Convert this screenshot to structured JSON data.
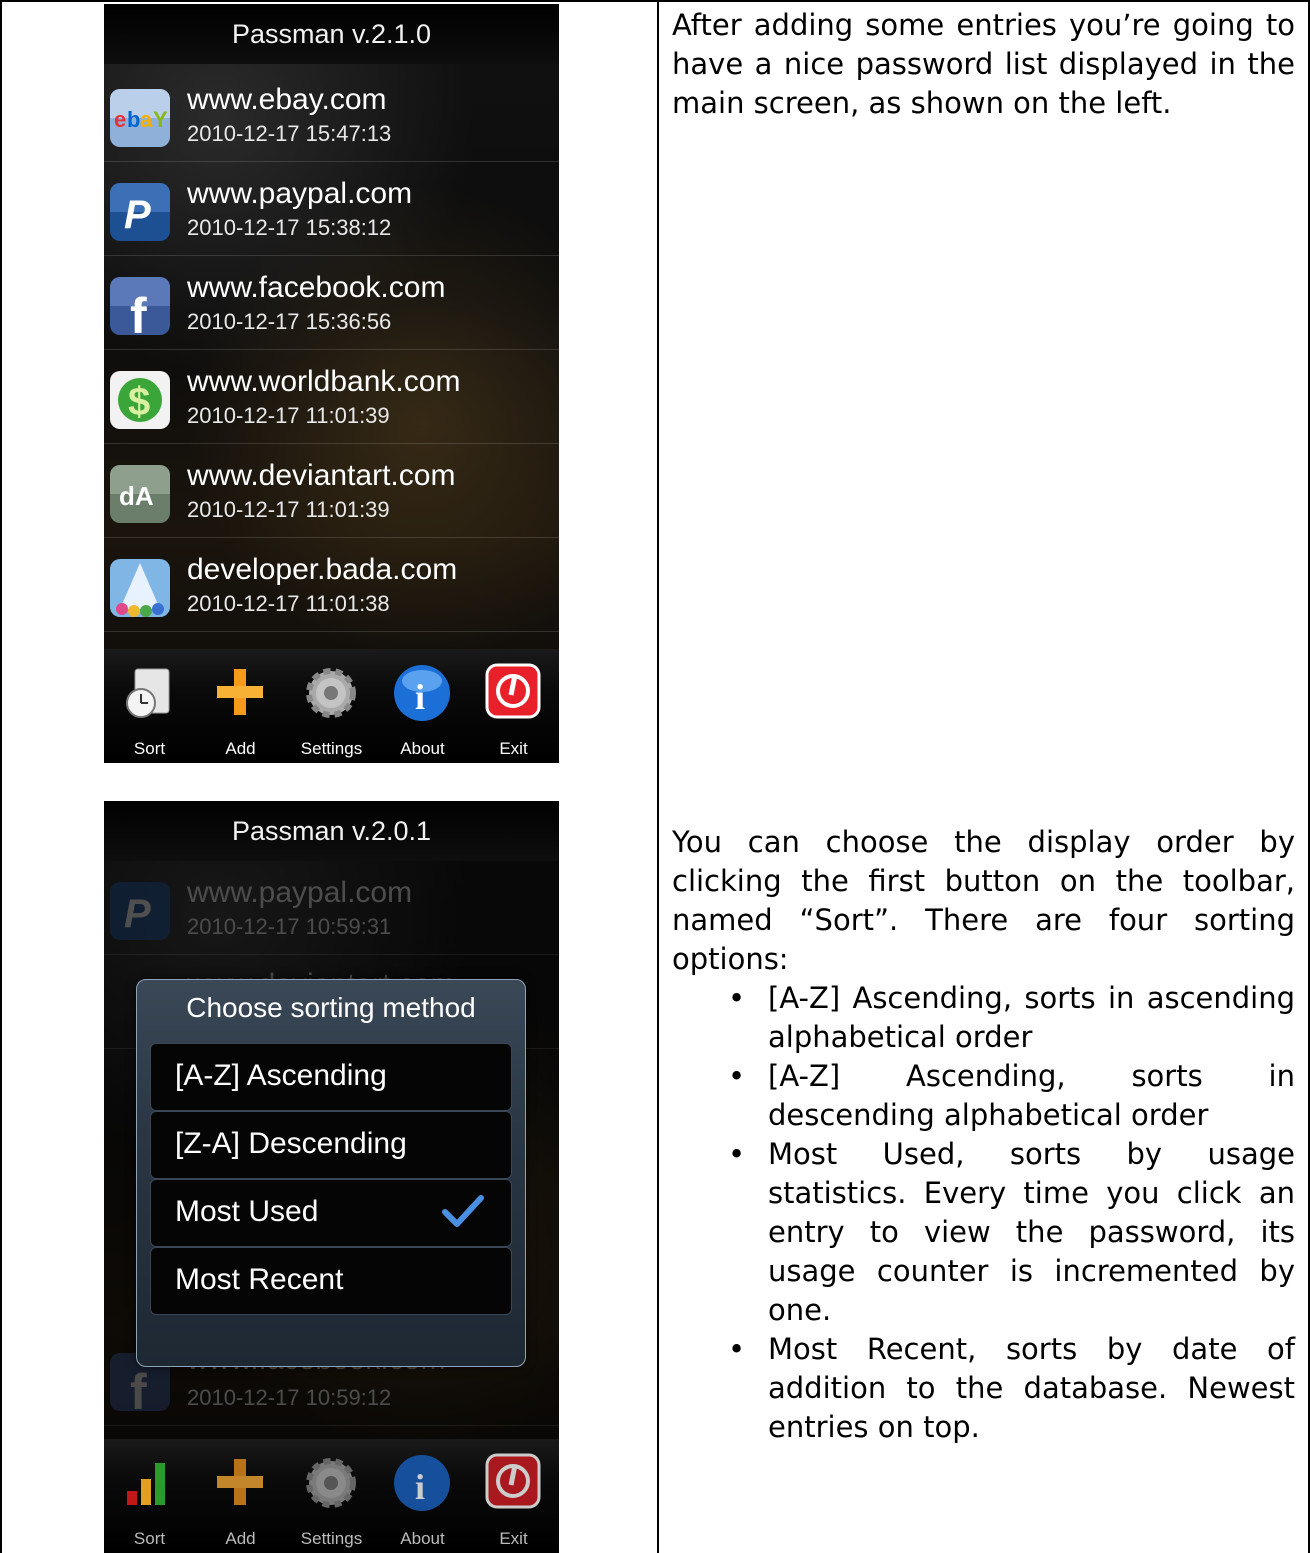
{
  "screen1": {
    "title": "Passman v.2.1.0",
    "entries": [
      {
        "site": "www.ebay.com",
        "date": "2010-12-17 15:47:13",
        "icon": "ebay-icon"
      },
      {
        "site": "www.paypal.com",
        "date": "2010-12-17 15:38:12",
        "icon": "paypal-icon"
      },
      {
        "site": "www.facebook.com",
        "date": "2010-12-17 15:36:56",
        "icon": "facebook-icon"
      },
      {
        "site": "www.worldbank.com",
        "date": "2010-12-17 11:01:39",
        "icon": "dollar-icon"
      },
      {
        "site": "www.deviantart.com",
        "date": "2010-12-17 11:01:39",
        "icon": "deviantart-icon"
      },
      {
        "site": "developer.bada.com",
        "date": "2010-12-17 11:01:38",
        "icon": "bada-icon"
      }
    ],
    "toolbar": [
      "Sort",
      "Add",
      "Settings",
      "About",
      "Exit"
    ]
  },
  "screen2": {
    "title": "Passman v.2.0.1",
    "entries": [
      {
        "site": "www.paypal.com",
        "date": "2010-12-17 10:59:31"
      },
      {
        "site": "www.deviantart.com",
        "date": ""
      },
      {
        "site": "www.facebook.com",
        "date": "2010-12-17 10:59:12"
      }
    ],
    "dialog": {
      "title": "Choose sorting method",
      "options": [
        "[A-Z] Ascending",
        "[Z-A] Descending",
        "Most Used",
        "Most Recent"
      ],
      "selected": "Most Used"
    },
    "toolbar": [
      "Sort",
      "Add",
      "Settings",
      "About",
      "Exit"
    ]
  },
  "text": {
    "para1": "After adding some entries you’re going to have a nice password list displayed in the main screen, as shown on the left.",
    "para2": "You can choose the display order by clicking the first button on the toolbar, named “Sort”. There are four sorting options:",
    "bullets": [
      "[A-Z] Ascending, sorts in ascending alphabetical order",
      "[A-Z] Ascending, sorts in descending alphabetical order",
      "Most Used, sorts by usage statistics. Every time you click an entry to view the password, its usage counter is incremented by one.",
      "Most Recent, sorts by date of addition to the database. Newest entries on top."
    ]
  }
}
